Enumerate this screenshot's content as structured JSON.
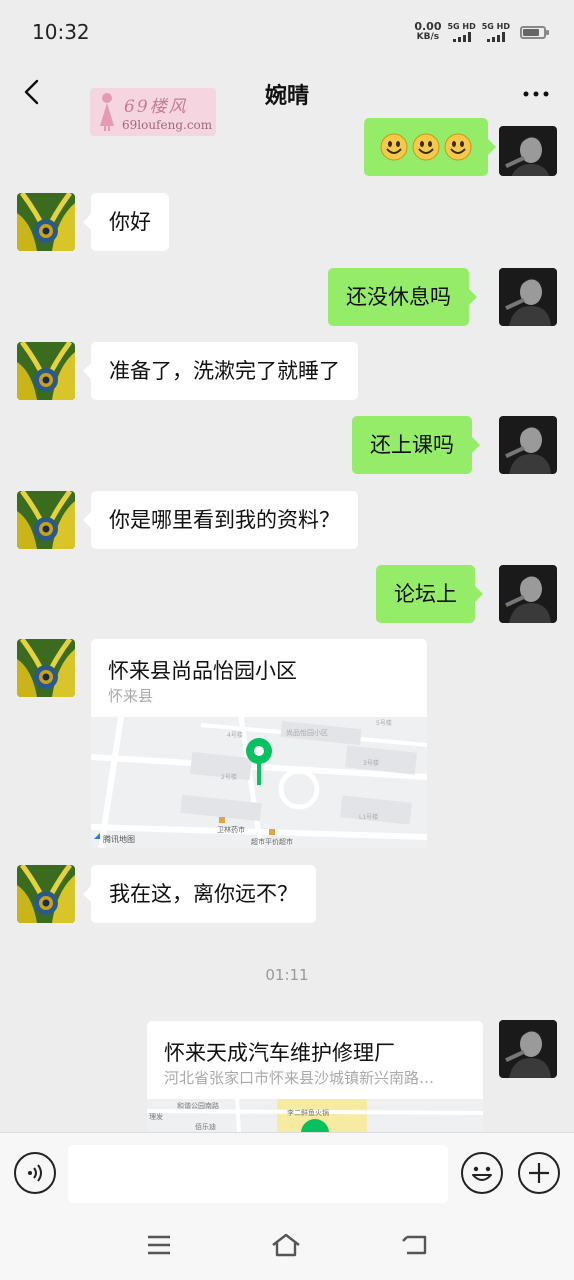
{
  "status_bar": {
    "time": "10:32",
    "net_speed_value": "0.00",
    "net_speed_unit": "KB/s",
    "sim1_label": "5G HD",
    "sim2_label": "5G HD",
    "battery_level": 0.8
  },
  "header": {
    "title": "婉晴",
    "back_icon": "chevron-left-icon",
    "more_icon": "more-dots-icon"
  },
  "watermark": {
    "title": "69楼风",
    "url": "69loufeng.com"
  },
  "messages": [
    {
      "side": "right",
      "type": "emoji",
      "emoji_count": 3
    },
    {
      "side": "left",
      "type": "text",
      "text": "你好"
    },
    {
      "side": "right",
      "type": "text",
      "text": "还没休息吗"
    },
    {
      "side": "left",
      "type": "text",
      "text": "准备了，洗漱完了就睡了"
    },
    {
      "side": "right",
      "type": "text",
      "text": "还上课吗"
    },
    {
      "side": "left",
      "type": "text",
      "text": "你是哪里看到我的资料？"
    },
    {
      "side": "right",
      "type": "text",
      "text": "论坛上"
    },
    {
      "side": "left",
      "type": "location",
      "name": "怀来县尚品怡园小区",
      "address": "怀来县",
      "map_labels": {
        "community": "尚品怡园小区",
        "bldg5": "5号楼",
        "bldg4": "4号楼",
        "bldg3": "3号楼",
        "bldg2": "2号楼",
        "bldgL1": "L1号楼",
        "clinic": "卫林药市",
        "supermarket": "超市平价超市",
        "provider": "腾讯地图"
      }
    },
    {
      "side": "left",
      "type": "text",
      "text": "我在这，离你远不？"
    },
    {
      "type": "timestamp",
      "text": "01:11"
    },
    {
      "side": "right",
      "type": "location",
      "name": "怀来天成汽车维护修理厂",
      "address": "河北省张家口市怀来县沙城镇新兴南路…",
      "map_labels": {
        "a": "和谐公园南路",
        "b": "李二鲜鱼火锅",
        "c": "理发",
        "d": "佰乐迪"
      }
    }
  ],
  "input_bar": {
    "voice_icon": "voice-icon",
    "input_value": "",
    "emoji_icon": "emoji-icon",
    "plus_icon": "plus-icon"
  },
  "system_nav": {
    "menu_icon": "menu-icon",
    "home_icon": "home-icon",
    "back_icon": "back-icon"
  }
}
